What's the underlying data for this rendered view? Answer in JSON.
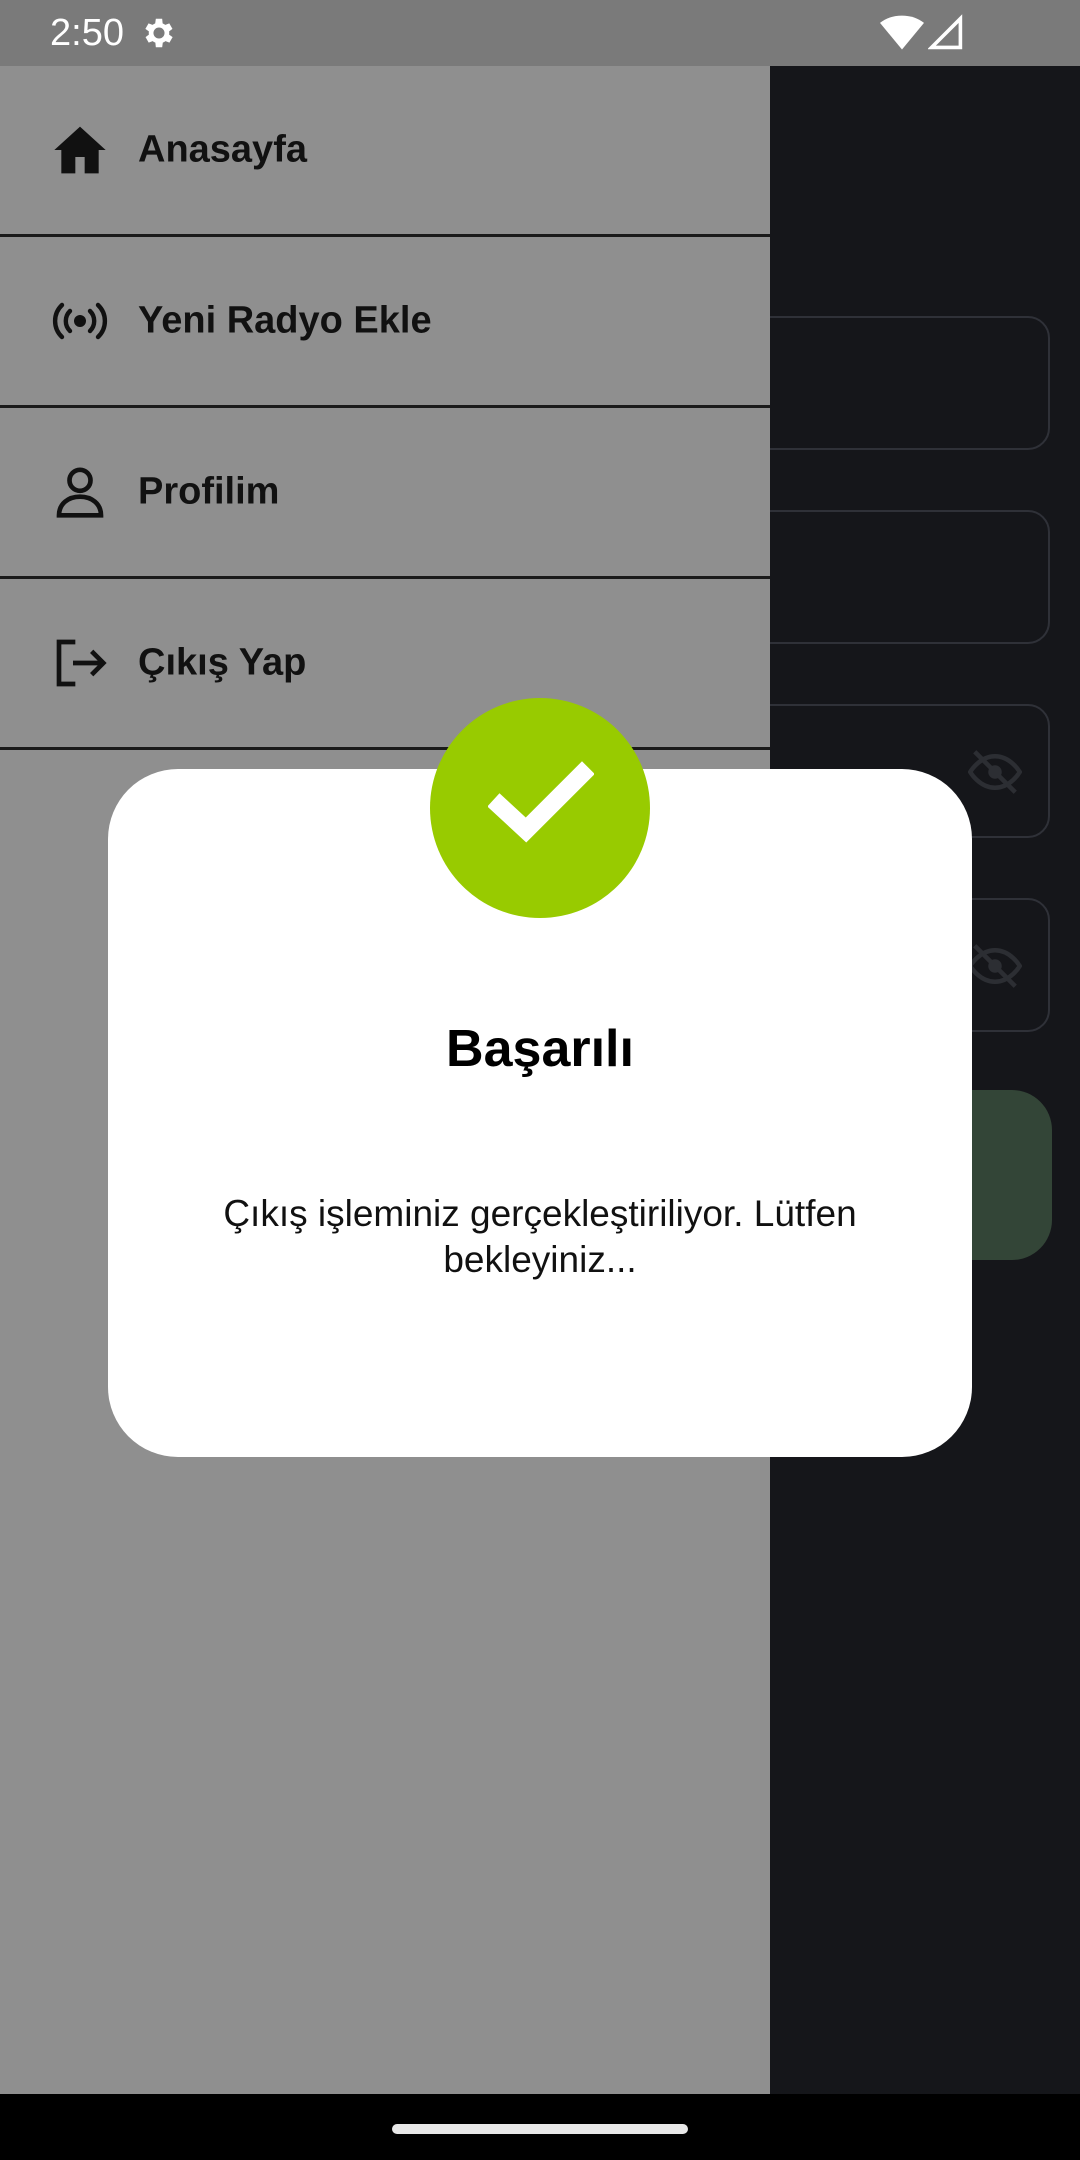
{
  "status_bar": {
    "time": "2:50",
    "icons": [
      "gear-icon",
      "wifi-icon",
      "signal-icon"
    ]
  },
  "drawer": {
    "items": [
      {
        "label": "Anasayfa",
        "icon": "home-icon"
      },
      {
        "label": "Yeni Radyo Ekle",
        "icon": "radio-broadcast-icon"
      },
      {
        "label": "Profilim",
        "icon": "person-icon"
      },
      {
        "label": "Çıkış Yap",
        "icon": "logout-icon"
      }
    ]
  },
  "dialog": {
    "icon": "check-icon",
    "title": "Başarılı",
    "message": "Çıkış işleminiz gerçekleştiriliyor. Lütfen bekleyiniz..."
  },
  "colors": {
    "success": "#98cb00",
    "drawer_bg": "#8f8f8f",
    "app_bg": "#15161a",
    "button_bg": "#334537"
  }
}
